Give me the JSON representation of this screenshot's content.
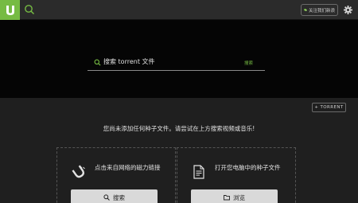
{
  "topbar": {
    "logo_icon": "utorrent-logo-icon",
    "search_icon": "search-icon",
    "follow_label": "关注我们新浪",
    "settings_icon": "gear-icon"
  },
  "hero": {
    "search_placeholder": "搜索 torrent 文件",
    "search_button": "搜索"
  },
  "content": {
    "add_torrent_label": "+ TORRENT",
    "empty_message": "您尚未添加任何种子文件。请尝试在上方搜索视频或音乐!",
    "cards": [
      {
        "icon": "magnet-icon",
        "text": "点击来自网络的磁力链接",
        "button_icon": "search-icon",
        "button_label": "搜索"
      },
      {
        "icon": "document-icon",
        "text": "打开您电脑中的种子文件",
        "button_icon": "folder-icon",
        "button_label": "浏览"
      }
    ]
  },
  "colors": {
    "accent": "#76bb43",
    "topbar": "#2b2b2b",
    "hero": "#050505",
    "content": "#1f1f1f"
  }
}
